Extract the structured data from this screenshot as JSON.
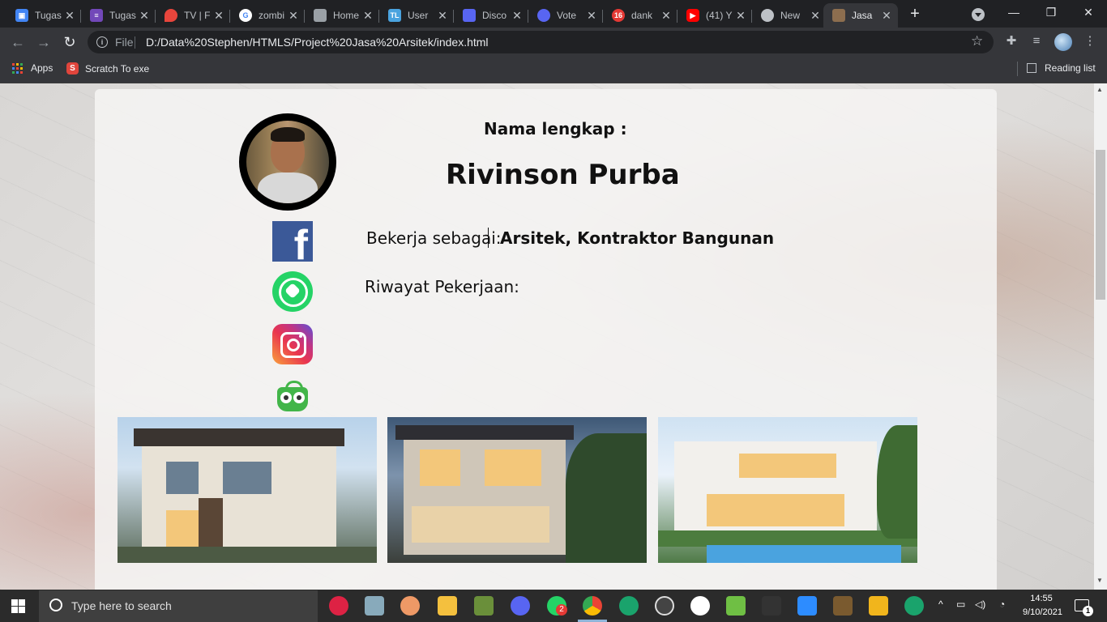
{
  "browser": {
    "tabs": [
      {
        "title": "Tugas",
        "favicon": "account-box-icon",
        "color": "#4285f4"
      },
      {
        "title": "Tugas",
        "favicon": "list-icon",
        "color": "#7248b9"
      },
      {
        "title": "TV | F",
        "favicon": "fire-icon",
        "color": "#e8453c"
      },
      {
        "title": "zombi",
        "favicon": "google-icon",
        "color": "#ffffff"
      },
      {
        "title": "Home",
        "favicon": "cube-icon",
        "color": "#9aa0a6"
      },
      {
        "title": "User",
        "favicon": "tl-icon",
        "color": "#4aa3df"
      },
      {
        "title": "Disco",
        "favicon": "discord-icon",
        "color": "#5865f2"
      },
      {
        "title": "Vote",
        "favicon": "discord-icon",
        "color": "#5865f2"
      },
      {
        "title": "dank",
        "favicon": "badge-16-icon",
        "color": "#e53935"
      },
      {
        "title": "(41) Y",
        "favicon": "youtube-icon",
        "color": "#ff0000"
      },
      {
        "title": "New",
        "favicon": "chrome-icon",
        "color": "#bdc1c6"
      },
      {
        "title": "Jasa",
        "favicon": "page-icon",
        "color": "#8d6e4f"
      }
    ],
    "url_scheme": "File",
    "url": "D:/Data%20Stephen/HTMLS/Project%20Jasa%20Arsitek/index.html",
    "bookmarks": [
      {
        "label": "Apps"
      },
      {
        "label": "Scratch To exe"
      }
    ],
    "reading_list": "Reading list"
  },
  "profile": {
    "name_label": "Nama lengkap :",
    "full_name": "Rivinson Purba",
    "job_label": "Bekerja sebagai:",
    "job": "Arsitek, Kontraktor Bangunan",
    "history_label": "Riwayat Pekerjaan:"
  },
  "social": [
    "facebook-icon",
    "whatsapp-icon",
    "instagram-icon",
    "tokopedia-icon"
  ],
  "portfolio": [
    "house-photo-1",
    "house-photo-2",
    "house-photo-3"
  ],
  "taskbar": {
    "search_placeholder": "Type here to search",
    "time": "14:55",
    "date": "9/10/2021",
    "notification_count": "1",
    "whatsapp_badge": "2"
  }
}
